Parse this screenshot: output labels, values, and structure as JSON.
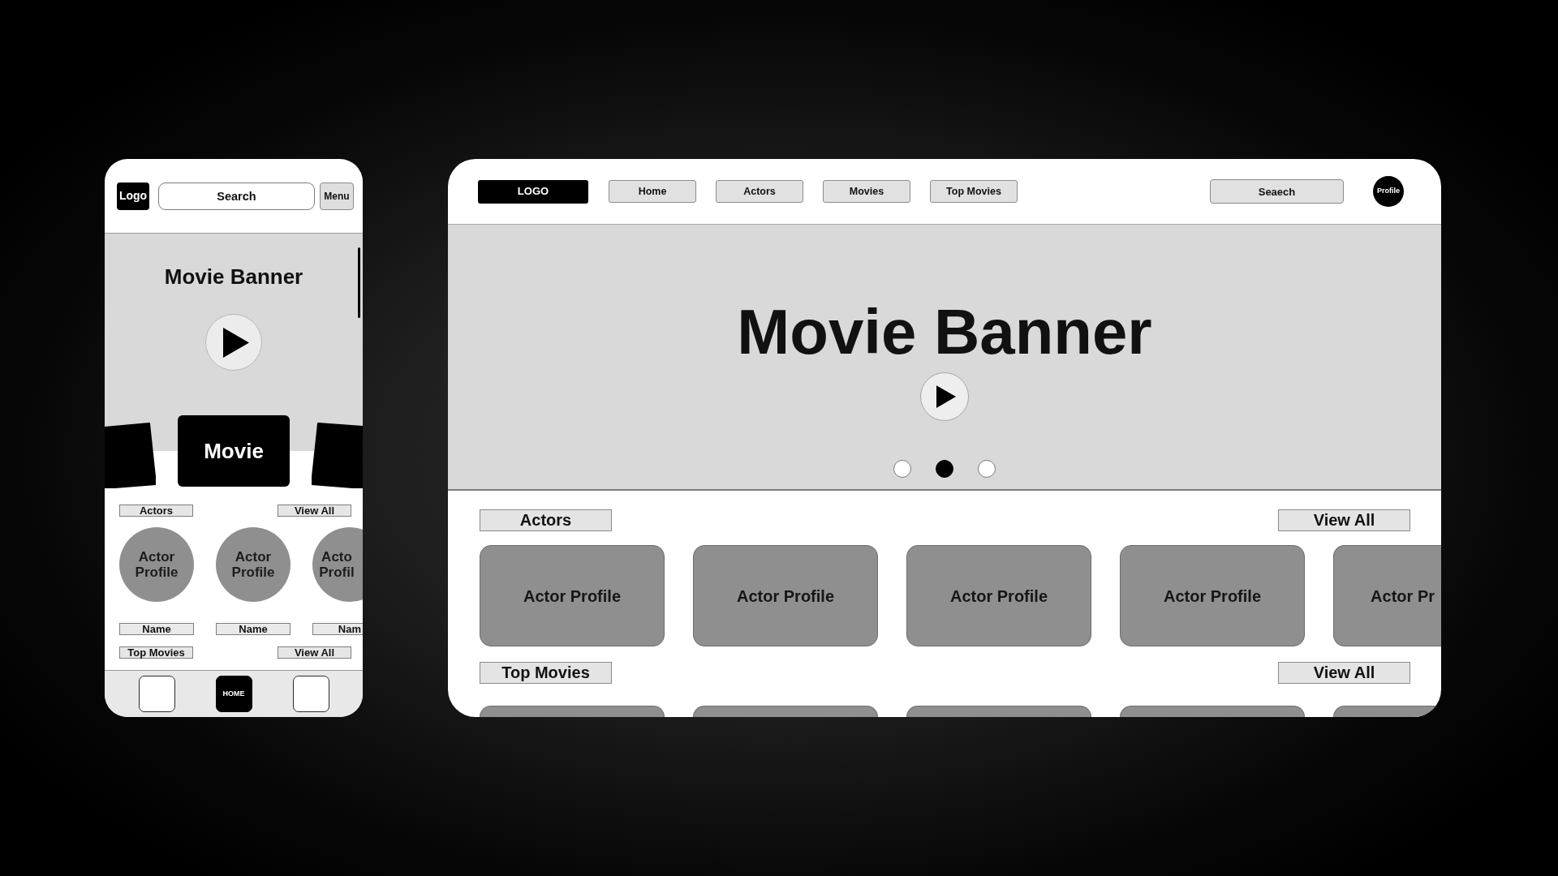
{
  "mobile": {
    "header": {
      "logo": "Logo",
      "search": {
        "placeholder": "Search"
      },
      "menu": "Menu"
    },
    "banner": {
      "title": "Movie Banner"
    },
    "movie_carousel": [
      {
        "kind": "left"
      },
      {
        "kind": "center",
        "label": "Movie"
      },
      {
        "kind": "right"
      }
    ],
    "actors": {
      "title": "Actors",
      "view_all": "View All",
      "items": [
        {
          "label": "Actor Profile",
          "name": "Name"
        },
        {
          "label": "Actor Profile",
          "name": "Name"
        },
        {
          "label": "Acto Profil",
          "name": "Nam"
        }
      ]
    },
    "top_movies": {
      "title": "Top Movies",
      "view_all": "View All"
    },
    "bottom_nav": [
      {
        "selected": false
      },
      {
        "label": "HOME",
        "selected": true
      },
      {
        "selected": false
      }
    ]
  },
  "desktop": {
    "logo": "LOGO",
    "nav_links": [
      "Home",
      "Actors",
      "Movies",
      "Top Movies"
    ],
    "search": {
      "placeholder": "Seaech"
    },
    "profile": "Profile",
    "banner": {
      "title": "Movie Banner",
      "dots": [
        {
          "selected": false
        },
        {
          "selected": true
        },
        {
          "selected": false
        }
      ]
    },
    "actors": {
      "title": "Actors",
      "view_all": "View All",
      "items": [
        "Actor Profile",
        "Actor Profile",
        "Actor Profile",
        "Actor Profile",
        "Actor Pr"
      ]
    },
    "top_movies": {
      "title": "Top Movies",
      "view_all": "View All"
    }
  }
}
